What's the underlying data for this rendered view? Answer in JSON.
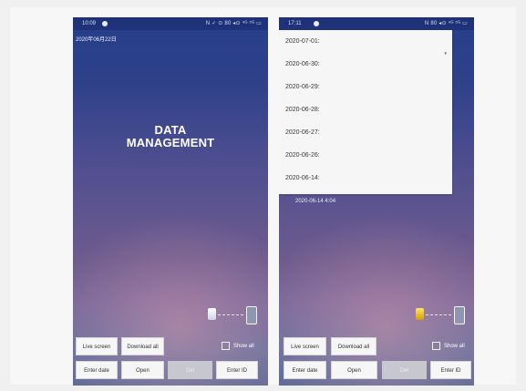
{
  "left_phone": {
    "status_time": "10:09",
    "status_icons": "N ✓ ⊙ 80 ◂⊙ ⁴ᴳ ⁵ᴳ ▭",
    "top_date": "2020年06月22日",
    "title_line1": "DATA",
    "title_line2": "MANAGEMENT",
    "buttons": {
      "live_screen": "Live screen",
      "download_all": "Download all",
      "enter_date": "Enter date",
      "open": "Open",
      "del": "Del",
      "enter_id": "Enter ID"
    },
    "show_all_label": "Show all"
  },
  "right_phone": {
    "status_time": "17:11",
    "status_icons": "N 80 ◂⊙ ⁴ᴳ ⁵ᴳ ▭",
    "dropdown_items": [
      "2020-07-01:",
      "2020-06-30:",
      "2020-06-29:",
      "2020-06-28:",
      "2020-06-27:",
      "2020-06-26:",
      "2020-06-14:"
    ],
    "selected_entry": "2020-06-14 4:04",
    "buttons": {
      "live_screen": "Live screen",
      "download_all": "Download all",
      "enter_date": "Enter date",
      "open": "Open",
      "del": "Del",
      "enter_id": "Enter ID"
    },
    "show_all_label": "Show all"
  },
  "colors": {
    "background": "#f0f0f0",
    "dropdown_bg": "#f6f6f6",
    "button_bg": "#f6f6f6",
    "button_disabled_bg": "#c7c7cf"
  }
}
